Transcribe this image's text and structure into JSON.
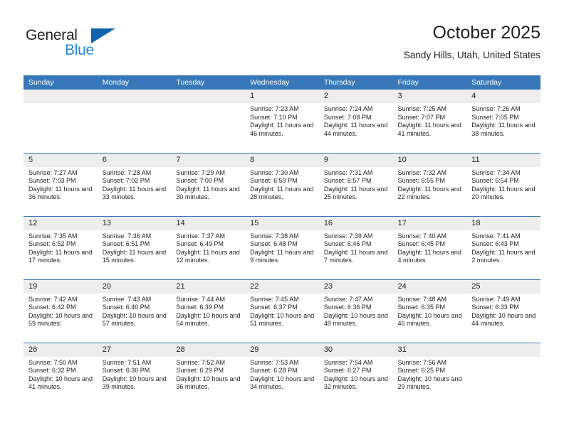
{
  "brand": {
    "name_part1": "General",
    "name_part2": "Blue",
    "triangle_color": "#1263ad",
    "blue_color": "#2585d3"
  },
  "header": {
    "title": "October 2025",
    "subtitle": "Sandy Hills, Utah, United States"
  },
  "theme": {
    "header_row_bg": "#3878b8",
    "daynum_bg": "#ededed",
    "text_color": "#231f20"
  },
  "weekdays": [
    "Sunday",
    "Monday",
    "Tuesday",
    "Wednesday",
    "Thursday",
    "Friday",
    "Saturday"
  ],
  "labels": {
    "sunrise_prefix": "Sunrise:",
    "sunset_prefix": "Sunset:",
    "daylight_prefix": "Daylight:"
  },
  "weeks": [
    [
      {
        "day": "",
        "empty": true
      },
      {
        "day": "",
        "empty": true
      },
      {
        "day": "",
        "empty": true
      },
      {
        "day": "1",
        "sunrise": "Sunrise: 7:23 AM",
        "sunset": "Sunset: 7:10 PM",
        "daylight": "Daylight: 11 hours and 46 minutes."
      },
      {
        "day": "2",
        "sunrise": "Sunrise: 7:24 AM",
        "sunset": "Sunset: 7:08 PM",
        "daylight": "Daylight: 11 hours and 44 minutes."
      },
      {
        "day": "3",
        "sunrise": "Sunrise: 7:25 AM",
        "sunset": "Sunset: 7:07 PM",
        "daylight": "Daylight: 11 hours and 41 minutes."
      },
      {
        "day": "4",
        "sunrise": "Sunrise: 7:26 AM",
        "sunset": "Sunset: 7:05 PM",
        "daylight": "Daylight: 11 hours and 38 minutes."
      }
    ],
    [
      {
        "day": "5",
        "sunrise": "Sunrise: 7:27 AM",
        "sunset": "Sunset: 7:03 PM",
        "daylight": "Daylight: 11 hours and 36 minutes."
      },
      {
        "day": "6",
        "sunrise": "Sunrise: 7:28 AM",
        "sunset": "Sunset: 7:02 PM",
        "daylight": "Daylight: 11 hours and 33 minutes."
      },
      {
        "day": "7",
        "sunrise": "Sunrise: 7:29 AM",
        "sunset": "Sunset: 7:00 PM",
        "daylight": "Daylight: 11 hours and 30 minutes."
      },
      {
        "day": "8",
        "sunrise": "Sunrise: 7:30 AM",
        "sunset": "Sunset: 6:59 PM",
        "daylight": "Daylight: 11 hours and 28 minutes."
      },
      {
        "day": "9",
        "sunrise": "Sunrise: 7:31 AM",
        "sunset": "Sunset: 6:57 PM",
        "daylight": "Daylight: 11 hours and 25 minutes."
      },
      {
        "day": "10",
        "sunrise": "Sunrise: 7:32 AM",
        "sunset": "Sunset: 6:55 PM",
        "daylight": "Daylight: 11 hours and 22 minutes."
      },
      {
        "day": "11",
        "sunrise": "Sunrise: 7:34 AM",
        "sunset": "Sunset: 6:54 PM",
        "daylight": "Daylight: 11 hours and 20 minutes."
      }
    ],
    [
      {
        "day": "12",
        "sunrise": "Sunrise: 7:35 AM",
        "sunset": "Sunset: 6:52 PM",
        "daylight": "Daylight: 11 hours and 17 minutes."
      },
      {
        "day": "13",
        "sunrise": "Sunrise: 7:36 AM",
        "sunset": "Sunset: 6:51 PM",
        "daylight": "Daylight: 11 hours and 15 minutes."
      },
      {
        "day": "14",
        "sunrise": "Sunrise: 7:37 AM",
        "sunset": "Sunset: 6:49 PM",
        "daylight": "Daylight: 11 hours and 12 minutes."
      },
      {
        "day": "15",
        "sunrise": "Sunrise: 7:38 AM",
        "sunset": "Sunset: 6:48 PM",
        "daylight": "Daylight: 11 hours and 9 minutes."
      },
      {
        "day": "16",
        "sunrise": "Sunrise: 7:39 AM",
        "sunset": "Sunset: 6:46 PM",
        "daylight": "Daylight: 11 hours and 7 minutes."
      },
      {
        "day": "17",
        "sunrise": "Sunrise: 7:40 AM",
        "sunset": "Sunset: 6:45 PM",
        "daylight": "Daylight: 11 hours and 4 minutes."
      },
      {
        "day": "18",
        "sunrise": "Sunrise: 7:41 AM",
        "sunset": "Sunset: 6:43 PM",
        "daylight": "Daylight: 11 hours and 2 minutes."
      }
    ],
    [
      {
        "day": "19",
        "sunrise": "Sunrise: 7:42 AM",
        "sunset": "Sunset: 6:42 PM",
        "daylight": "Daylight: 10 hours and 59 minutes."
      },
      {
        "day": "20",
        "sunrise": "Sunrise: 7:43 AM",
        "sunset": "Sunset: 6:40 PM",
        "daylight": "Daylight: 10 hours and 57 minutes."
      },
      {
        "day": "21",
        "sunrise": "Sunrise: 7:44 AM",
        "sunset": "Sunset: 6:39 PM",
        "daylight": "Daylight: 10 hours and 54 minutes."
      },
      {
        "day": "22",
        "sunrise": "Sunrise: 7:45 AM",
        "sunset": "Sunset: 6:37 PM",
        "daylight": "Daylight: 10 hours and 51 minutes."
      },
      {
        "day": "23",
        "sunrise": "Sunrise: 7:47 AM",
        "sunset": "Sunset: 6:36 PM",
        "daylight": "Daylight: 10 hours and 49 minutes."
      },
      {
        "day": "24",
        "sunrise": "Sunrise: 7:48 AM",
        "sunset": "Sunset: 6:35 PM",
        "daylight": "Daylight: 10 hours and 46 minutes."
      },
      {
        "day": "25",
        "sunrise": "Sunrise: 7:49 AM",
        "sunset": "Sunset: 6:33 PM",
        "daylight": "Daylight: 10 hours and 44 minutes."
      }
    ],
    [
      {
        "day": "26",
        "sunrise": "Sunrise: 7:50 AM",
        "sunset": "Sunset: 6:32 PM",
        "daylight": "Daylight: 10 hours and 41 minutes."
      },
      {
        "day": "27",
        "sunrise": "Sunrise: 7:51 AM",
        "sunset": "Sunset: 6:30 PM",
        "daylight": "Daylight: 10 hours and 39 minutes."
      },
      {
        "day": "28",
        "sunrise": "Sunrise: 7:52 AM",
        "sunset": "Sunset: 6:29 PM",
        "daylight": "Daylight: 10 hours and 36 minutes."
      },
      {
        "day": "29",
        "sunrise": "Sunrise: 7:53 AM",
        "sunset": "Sunset: 6:28 PM",
        "daylight": "Daylight: 10 hours and 34 minutes."
      },
      {
        "day": "30",
        "sunrise": "Sunrise: 7:54 AM",
        "sunset": "Sunset: 6:27 PM",
        "daylight": "Daylight: 10 hours and 32 minutes."
      },
      {
        "day": "31",
        "sunrise": "Sunrise: 7:56 AM",
        "sunset": "Sunset: 6:25 PM",
        "daylight": "Daylight: 10 hours and 29 minutes."
      },
      {
        "day": "",
        "empty": true
      }
    ]
  ]
}
